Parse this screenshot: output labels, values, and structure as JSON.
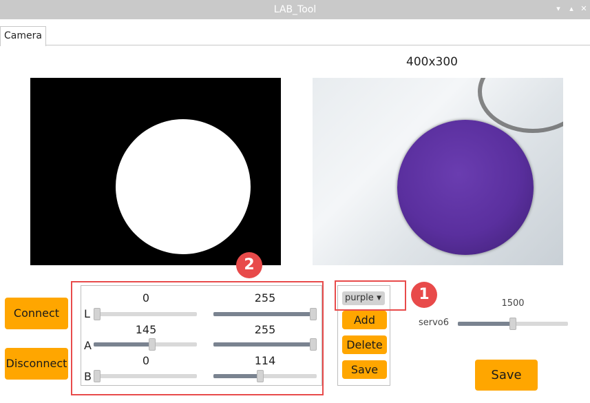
{
  "window": {
    "title": "LAB_Tool",
    "controls": [
      "▾",
      "▴",
      "✕"
    ]
  },
  "tabs": [
    {
      "label": "Camera"
    }
  ],
  "camera": {
    "resolution_label": "400x300"
  },
  "buttons": {
    "connect": "Connect",
    "disconnect": "Disconnect"
  },
  "channels": {
    "L": {
      "label": "L",
      "min": 0,
      "max": 255,
      "min_text": "0",
      "max_text": "255"
    },
    "A": {
      "label": "A",
      "min": 145,
      "max": 255,
      "min_text": "145",
      "max_text": "255"
    },
    "B": {
      "label": "B",
      "min": 0,
      "max": 114,
      "min_text": "0",
      "max_text": "114"
    }
  },
  "color_panel": {
    "selected_color": "purple",
    "add": "Add",
    "delete": "Delete",
    "save": "Save"
  },
  "servo": {
    "label": "servo6",
    "value": 1500,
    "value_text": "1500",
    "range": [
      500,
      2500
    ]
  },
  "save_button": "Save",
  "annotations": [
    {
      "number": "1"
    },
    {
      "number": "2"
    }
  ],
  "colors": {
    "accent": "#ffa600",
    "annotation": "#e84a4a",
    "titlebar": "#c9c9c9",
    "ball": "#5a2f9e"
  }
}
